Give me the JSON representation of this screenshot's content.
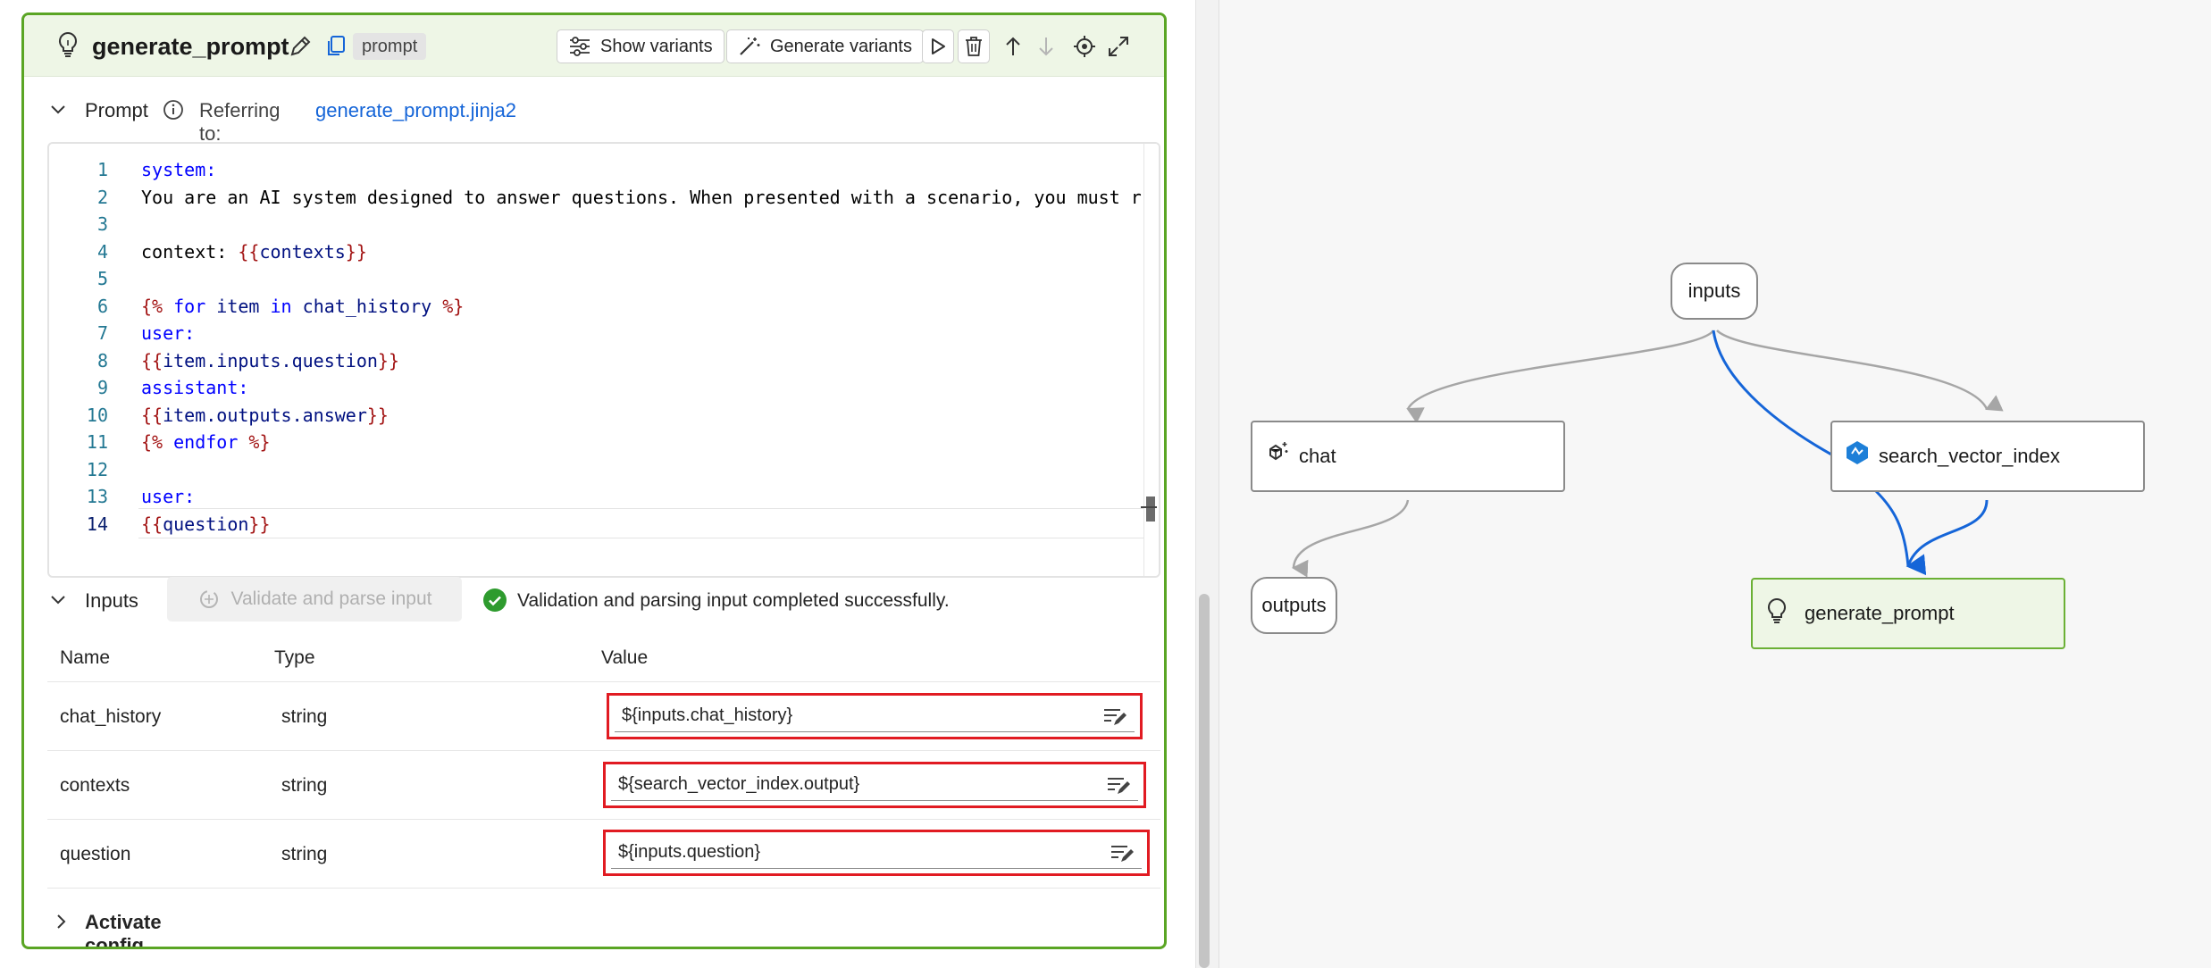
{
  "node": {
    "title": "generate_prompt",
    "type_badge": "prompt",
    "buttons": {
      "show_variants": "Show variants",
      "generate_variants": "Generate variants"
    }
  },
  "prompt_section": {
    "label": "Prompt",
    "referring_label": "Referring to:",
    "referring_file": "generate_prompt.jinja2"
  },
  "code_lines": [
    {
      "n": "1",
      "parts": [
        [
          "k1",
          "system:"
        ]
      ]
    },
    {
      "n": "2",
      "parts": [
        [
          "tx",
          "You are an AI system designed to answer questions. When presented with a scenario, you must r"
        ]
      ]
    },
    {
      "n": "3",
      "parts": []
    },
    {
      "n": "4",
      "parts": [
        [
          "tx",
          "context: "
        ],
        [
          "br",
          "{{"
        ],
        [
          "vr",
          "contexts"
        ],
        [
          "br",
          "}}"
        ]
      ]
    },
    {
      "n": "5",
      "parts": []
    },
    {
      "n": "6",
      "parts": [
        [
          "br",
          "{% "
        ],
        [
          "k2",
          "for"
        ],
        [
          "tx",
          " "
        ],
        [
          "vr",
          "item"
        ],
        [
          "tx",
          " "
        ],
        [
          "k2",
          "in"
        ],
        [
          "tx",
          " "
        ],
        [
          "vr",
          "chat_history"
        ],
        [
          "br",
          " %}"
        ]
      ]
    },
    {
      "n": "7",
      "parts": [
        [
          "k1",
          "user:"
        ]
      ]
    },
    {
      "n": "8",
      "parts": [
        [
          "br",
          "{{"
        ],
        [
          "vr",
          "item.inputs.question"
        ],
        [
          "br",
          "}}"
        ]
      ]
    },
    {
      "n": "9",
      "parts": [
        [
          "k1",
          "assistant:"
        ]
      ]
    },
    {
      "n": "10",
      "parts": [
        [
          "br",
          "{{"
        ],
        [
          "vr",
          "item.outputs.answer"
        ],
        [
          "br",
          "}}"
        ]
      ]
    },
    {
      "n": "11",
      "parts": [
        [
          "br",
          "{% "
        ],
        [
          "k2",
          "endfor"
        ],
        [
          "br",
          " %}"
        ]
      ]
    },
    {
      "n": "12",
      "parts": []
    },
    {
      "n": "13",
      "parts": [
        [
          "k1",
          "user:"
        ]
      ]
    },
    {
      "n": "14",
      "parts": [
        [
          "br",
          "{{"
        ],
        [
          "vr",
          "question"
        ],
        [
          "br",
          "}}"
        ]
      ]
    }
  ],
  "inputs_section": {
    "label": "Inputs",
    "validate_button": "Validate and parse input",
    "status_message": "Validation and parsing input completed successfully.",
    "columns": [
      "Name",
      "Type",
      "Value"
    ],
    "rows": [
      {
        "name": "chat_history",
        "type": "string",
        "value": "${inputs.chat_history}"
      },
      {
        "name": "contexts",
        "type": "string",
        "value": "${search_vector_index.output}"
      },
      {
        "name": "question",
        "type": "string",
        "value": "${inputs.question}"
      }
    ]
  },
  "activate_config": {
    "label": "Activate config"
  },
  "graph": {
    "nodes": {
      "inputs": "inputs",
      "chat": "chat",
      "search_vector_index": "search_vector_index",
      "outputs": "outputs",
      "generate_prompt": "generate_prompt"
    },
    "colors": {
      "active_edge": "#1565d8",
      "edge": "#a6a6a6",
      "active_node": "#eef6e6",
      "panel_border": "#5aa524",
      "highlight": "#e11b22"
    }
  }
}
